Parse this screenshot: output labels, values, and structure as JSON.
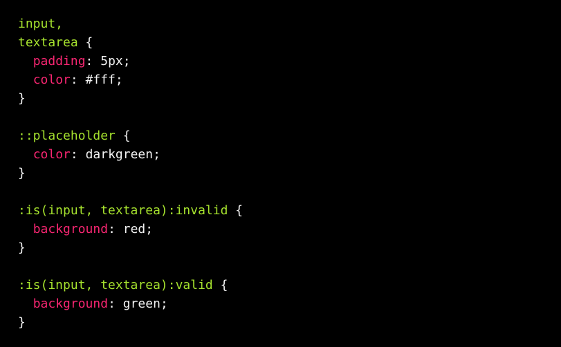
{
  "editor": {
    "theme_colors": {
      "background": "#000000",
      "selector": "#a6e22e",
      "property": "#f92672",
      "text": "#f2f2f2"
    },
    "lines": [
      [
        {
          "t": "sel",
          "v": "input,"
        }
      ],
      [
        {
          "t": "sel",
          "v": "textarea"
        },
        {
          "t": "punc",
          "v": " {"
        }
      ],
      [
        {
          "t": "punc",
          "v": "  "
        },
        {
          "t": "prop",
          "v": "padding"
        },
        {
          "t": "punc",
          "v": ": "
        },
        {
          "t": "val",
          "v": "5px"
        },
        {
          "t": "punc",
          "v": ";"
        }
      ],
      [
        {
          "t": "punc",
          "v": "  "
        },
        {
          "t": "prop",
          "v": "color"
        },
        {
          "t": "punc",
          "v": ": "
        },
        {
          "t": "val",
          "v": "#fff"
        },
        {
          "t": "punc",
          "v": ";"
        }
      ],
      [
        {
          "t": "punc",
          "v": "}"
        }
      ],
      [],
      [
        {
          "t": "sel",
          "v": "::placeholder"
        },
        {
          "t": "punc",
          "v": " {"
        }
      ],
      [
        {
          "t": "punc",
          "v": "  "
        },
        {
          "t": "prop",
          "v": "color"
        },
        {
          "t": "punc",
          "v": ": "
        },
        {
          "t": "val",
          "v": "darkgreen"
        },
        {
          "t": "punc",
          "v": ";"
        }
      ],
      [
        {
          "t": "punc",
          "v": "}"
        }
      ],
      [],
      [
        {
          "t": "sel",
          "v": ":is(input, textarea):invalid"
        },
        {
          "t": "punc",
          "v": " {"
        }
      ],
      [
        {
          "t": "punc",
          "v": "  "
        },
        {
          "t": "prop",
          "v": "background"
        },
        {
          "t": "punc",
          "v": ": "
        },
        {
          "t": "val",
          "v": "red"
        },
        {
          "t": "punc",
          "v": ";"
        }
      ],
      [
        {
          "t": "punc",
          "v": "}"
        }
      ],
      [],
      [
        {
          "t": "sel",
          "v": ":is(input, textarea):valid"
        },
        {
          "t": "punc",
          "v": " {"
        }
      ],
      [
        {
          "t": "punc",
          "v": "  "
        },
        {
          "t": "prop",
          "v": "background"
        },
        {
          "t": "punc",
          "v": ": "
        },
        {
          "t": "val",
          "v": "green"
        },
        {
          "t": "punc",
          "v": ";"
        }
      ],
      [
        {
          "t": "punc",
          "v": "}"
        }
      ]
    ]
  }
}
